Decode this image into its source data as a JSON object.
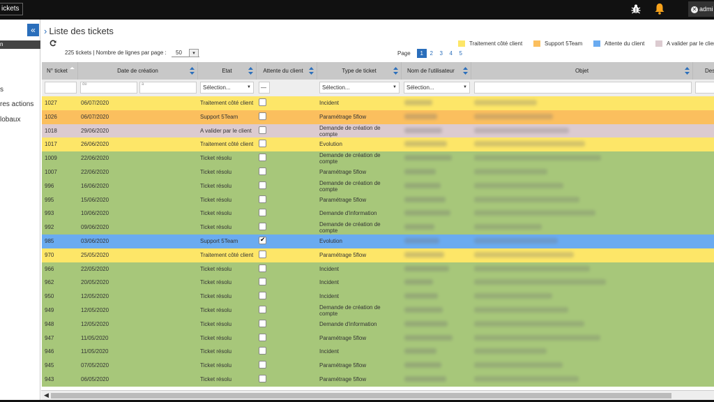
{
  "topbar": {
    "tab_label": "ickets",
    "user_label": "admi"
  },
  "sidebar": {
    "items": [
      "s",
      "res actions",
      "lobaux"
    ]
  },
  "page": {
    "title": "Liste des tickets",
    "count_text": "225 tickets  |  Nombre de lignes par page :",
    "rows_per_page": "50",
    "page_label": "Page",
    "pages": [
      "1",
      "2",
      "3",
      "4",
      "5"
    ],
    "current_page": "1"
  },
  "legend": [
    {
      "label": "Traitement côté client",
      "color": "#fde668"
    },
    {
      "label": "Support 5Team",
      "color": "#fbbf5e"
    },
    {
      "label": "Attente du client",
      "color": "#6aabf0"
    },
    {
      "label": "A valider par le client",
      "color": "#dccbd0"
    }
  ],
  "columns": [
    "N° ticket",
    "Date de création",
    "Etat",
    "Attente du client",
    "Type de ticket",
    "Nom de l'utilisateur",
    "Objet",
    "Des"
  ],
  "filters": {
    "date_from": "de",
    "date_to": "à",
    "select_placeholder": "Sélection...",
    "dash": "—"
  },
  "colors": {
    "resolved": "#a7c77a",
    "treat_client": "#fde668",
    "support": "#fbbf5e",
    "attente": "#6aabf0",
    "valider": "#dccbd0"
  },
  "rows": [
    {
      "id": "1027",
      "date": "06/07/2020",
      "etat": "Traitement côté client",
      "attente": false,
      "type": "Incident",
      "status": "treat_client"
    },
    {
      "id": "1026",
      "date": "06/07/2020",
      "etat": "Support 5Team",
      "attente": false,
      "type": "Paramétrage 5flow",
      "status": "support"
    },
    {
      "id": "1018",
      "date": "29/06/2020",
      "etat": "A valider par le client",
      "attente": false,
      "type": "Demande de création de compte",
      "status": "valider"
    },
    {
      "id": "1017",
      "date": "26/06/2020",
      "etat": "Traitement côté client",
      "attente": false,
      "type": "Evolution",
      "status": "treat_client"
    },
    {
      "id": "1009",
      "date": "22/06/2020",
      "etat": "Ticket résolu",
      "attente": false,
      "type": "Demande de création de compte",
      "status": "resolved"
    },
    {
      "id": "1007",
      "date": "22/06/2020",
      "etat": "Ticket résolu",
      "attente": false,
      "type": "Paramétrage 5flow",
      "status": "resolved"
    },
    {
      "id": "996",
      "date": "16/06/2020",
      "etat": "Ticket résolu",
      "attente": false,
      "type": "Demande de création de compte",
      "status": "resolved"
    },
    {
      "id": "995",
      "date": "15/06/2020",
      "etat": "Ticket résolu",
      "attente": false,
      "type": "Paramétrage 5flow",
      "status": "resolved"
    },
    {
      "id": "993",
      "date": "10/06/2020",
      "etat": "Ticket résolu",
      "attente": false,
      "type": "Demande d'information",
      "status": "resolved"
    },
    {
      "id": "992",
      "date": "09/06/2020",
      "etat": "Ticket résolu",
      "attente": false,
      "type": "Demande de création de compte",
      "status": "resolved"
    },
    {
      "id": "985",
      "date": "03/06/2020",
      "etat": "Support 5Team",
      "attente": true,
      "type": "Evolution",
      "status": "attente"
    },
    {
      "id": "970",
      "date": "25/05/2020",
      "etat": "Traitement côté client",
      "attente": false,
      "type": "Paramétrage 5flow",
      "status": "treat_client"
    },
    {
      "id": "966",
      "date": "22/05/2020",
      "etat": "Ticket résolu",
      "attente": false,
      "type": "Incident",
      "status": "resolved"
    },
    {
      "id": "962",
      "date": "20/05/2020",
      "etat": "Ticket résolu",
      "attente": false,
      "type": "Incident",
      "status": "resolved"
    },
    {
      "id": "950",
      "date": "12/05/2020",
      "etat": "Ticket résolu",
      "attente": false,
      "type": "Incident",
      "status": "resolved"
    },
    {
      "id": "949",
      "date": "12/05/2020",
      "etat": "Ticket résolu",
      "attente": false,
      "type": "Demande de création de compte",
      "status": "resolved"
    },
    {
      "id": "948",
      "date": "12/05/2020",
      "etat": "Ticket résolu",
      "attente": false,
      "type": "Demande d'information",
      "status": "resolved"
    },
    {
      "id": "947",
      "date": "11/05/2020",
      "etat": "Ticket résolu",
      "attente": false,
      "type": "Paramétrage 5flow",
      "status": "resolved"
    },
    {
      "id": "946",
      "date": "11/05/2020",
      "etat": "Ticket résolu",
      "attente": false,
      "type": "Incident",
      "status": "resolved"
    },
    {
      "id": "945",
      "date": "07/05/2020",
      "etat": "Ticket résolu",
      "attente": false,
      "type": "Paramétrage 5flow",
      "status": "resolved"
    },
    {
      "id": "943",
      "date": "06/05/2020",
      "etat": "Ticket résolu",
      "attente": false,
      "type": "Paramétrage 5flow",
      "status": "resolved"
    }
  ]
}
